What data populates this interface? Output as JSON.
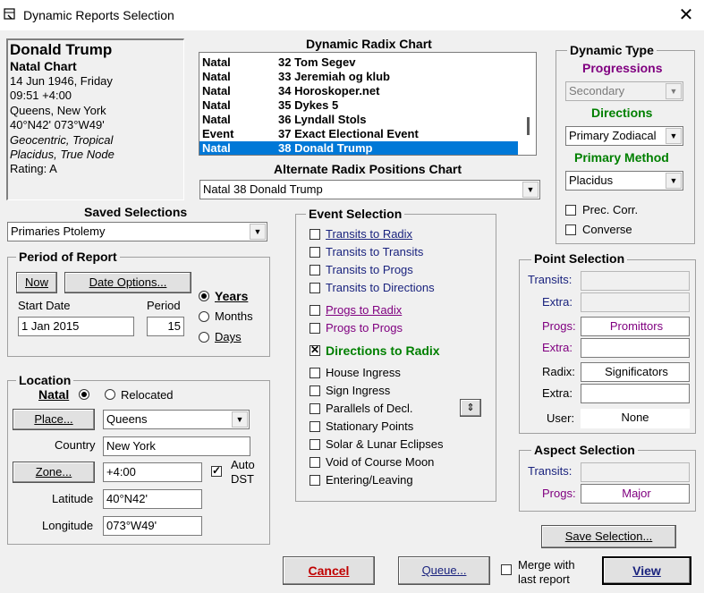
{
  "window": {
    "title": "Dynamic Reports Selection"
  },
  "person": {
    "name": "Donald Trump",
    "chart_type": "Natal Chart",
    "date": "14 Jun 1946, Friday",
    "time": "09:51  +4:00",
    "place": "Queens, New York",
    "coords": "40°N42' 073°W49'",
    "system_line1": "Geocentric, Tropical",
    "system_line2": "Placidus, True Node",
    "rating": "Rating: A"
  },
  "radix": {
    "title": "Dynamic Radix Chart",
    "rows": [
      {
        "type": "Natal",
        "name": "32 Tom Segev"
      },
      {
        "type": "Natal",
        "name": "33 Jeremiah og klub"
      },
      {
        "type": "Natal",
        "name": "34 Horoskoper.net"
      },
      {
        "type": "Natal",
        "name": "35 Dykes 5"
      },
      {
        "type": "Natal",
        "name": "36 Lyndall Stols"
      },
      {
        "type": "Event",
        "name": "37 Exact Electional Event"
      },
      {
        "type": "Natal",
        "name": "38 Donald Trump"
      }
    ],
    "alt_title": "Alternate Radix Positions Chart",
    "alt_value": "Natal 38 Donald Trump"
  },
  "dynamic_type": {
    "title": "Dynamic Type",
    "progressions_label": "Progressions",
    "progressions_value": "Secondary",
    "directions_label": "Directions",
    "directions_value": "Primary Zodiacal",
    "method_label": "Primary Method",
    "method_value": "Placidus",
    "prec_corr": "Prec. Corr.",
    "converse": "Converse"
  },
  "saved": {
    "title": "Saved Selections",
    "value": "Primaries Ptolemy"
  },
  "period": {
    "title": "Period of Report",
    "now": "Now",
    "date_options": "Date Options...",
    "start_label": "Start Date",
    "start_value": "1 Jan 2015",
    "period_label": "Period",
    "period_value": "15",
    "years": "Years",
    "months": "Months",
    "days": "Days"
  },
  "location": {
    "title": "Location",
    "natal": "Natal",
    "relocated": "Relocated",
    "place_btn": "Place...",
    "place_value": "Queens",
    "country_label": "Country",
    "country_value": "New York",
    "zone_btn": "Zone...",
    "zone_value": "+4:00",
    "auto_dst_1": "Auto",
    "auto_dst_2": "DST",
    "lat_label": "Latitude",
    "lat_value": "40°N42'",
    "lon_label": "Longitude",
    "lon_value": "073°W49'"
  },
  "events": {
    "title": "Event Selection",
    "transits_radix": "Transits to Radix",
    "transits_transits": "Transits to Transits",
    "transits_progs": "Transits to Progs",
    "transits_directions": "Transits to Directions",
    "progs_radix": "Progs to Radix",
    "progs_progs": "Progs to Progs",
    "directions_radix": "Directions to Radix",
    "house_ingress": "House Ingress",
    "sign_ingress": "Sign Ingress",
    "parallels": "Parallels of Decl.",
    "stationary": "Stationary Points",
    "eclipses": "Solar & Lunar Eclipses",
    "void": "Void of Course Moon",
    "entering": "Entering/Leaving"
  },
  "point": {
    "title": "Point Selection",
    "transits": "Transits:",
    "extra": "Extra:",
    "progs": "Progs:",
    "progs_value": "Promittors",
    "radix": "Radix:",
    "radix_value": "Significators",
    "user": "User:",
    "user_value": "None"
  },
  "aspect": {
    "title": "Aspect Selection",
    "transits": "Transits:",
    "progs": "Progs:",
    "progs_value": "Major"
  },
  "buttons": {
    "save_selection": "Save Selection...",
    "cancel": "Cancel",
    "queue": "Queue...",
    "merge_1": "Merge with",
    "merge_2": "last report",
    "view": "View"
  }
}
